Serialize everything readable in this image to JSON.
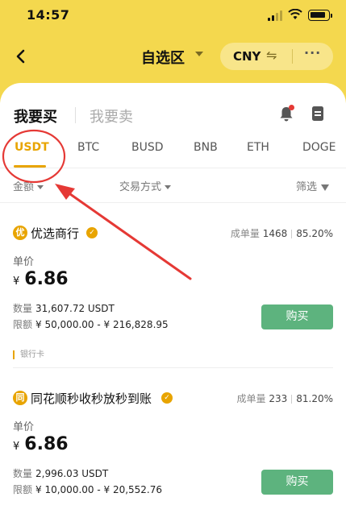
{
  "status_bar": {
    "time": "14:57"
  },
  "nav": {
    "back_icon": "chevron-left-icon",
    "title": "自选区",
    "currency": "CNY",
    "swap_icon": "⇋",
    "more_icon": "···"
  },
  "trade_tabs": {
    "buy": "我要买",
    "sell": "我要卖"
  },
  "coins": [
    {
      "label": "USDT",
      "active": true
    },
    {
      "label": "BTC"
    },
    {
      "label": "BUSD"
    },
    {
      "label": "BNB"
    },
    {
      "label": "ETH"
    },
    {
      "label": "DOGE"
    }
  ],
  "filters": {
    "amount": "金额",
    "payment": "交易方式",
    "filter": "筛选"
  },
  "listings": [
    {
      "avatar": "优",
      "merchant": "优选商行",
      "orders_label": "成单量",
      "orders": "1468",
      "completion": "85.20%",
      "price_label": "单价",
      "currency_symbol": "¥",
      "price": "6.86",
      "qty_label": "数量",
      "qty": "31,607.72 USDT",
      "limit_label": "限额",
      "limit": "¥ 50,000.00 - ¥ 216,828.95",
      "button": "购买",
      "payment_method": "银行卡"
    },
    {
      "avatar": "同",
      "merchant": "同花顺秒收秒放秒到账",
      "orders_label": "成单量",
      "orders": "233",
      "completion": "81.20%",
      "price_label": "单价",
      "currency_symbol": "¥",
      "price": "6.86",
      "qty_label": "数量",
      "qty": "2,996.03 USDT",
      "limit_label": "限额",
      "limit": "¥ 10,000.00 - ¥ 20,552.76",
      "button": "购买"
    }
  ],
  "colors": {
    "brand_yellow": "#F4D84E",
    "accent": "#E8A400",
    "buy_green": "#5DB37E",
    "annotation_red": "#E53935"
  }
}
